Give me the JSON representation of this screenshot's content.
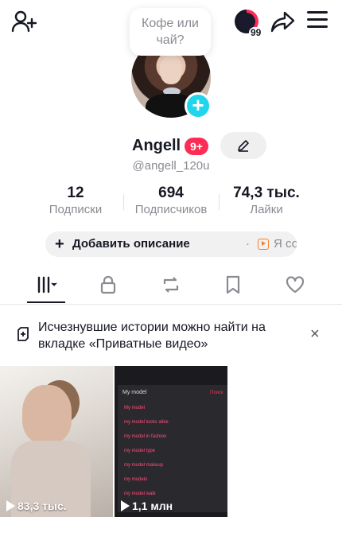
{
  "header": {
    "add_friend_icon": "add-friend-icon",
    "status_bubble": [
      "Кофе или",
      "чай?"
    ],
    "notification_count": "99",
    "share_icon": "share-icon",
    "menu_icon": "hamburger-menu-icon"
  },
  "profile": {
    "name": "Angell",
    "badge": "9+",
    "handle": "@angell_120u",
    "stats": [
      {
        "value": "12",
        "label": "Подписки"
      },
      {
        "value": "694",
        "label": "Подписчиков"
      },
      {
        "value": "74,3 тыс.",
        "label": "Лайки"
      }
    ],
    "description_button": "Добавить описание",
    "description_separator": "·",
    "create_label": "Я созда..."
  },
  "tabs": [
    {
      "name": "videos-grid",
      "icon": "grid-icon",
      "active": true
    },
    {
      "name": "private",
      "icon": "lock-icon"
    },
    {
      "name": "reposts",
      "icon": "repost-icon"
    },
    {
      "name": "saved",
      "icon": "bookmark-icon"
    },
    {
      "name": "liked",
      "icon": "heart-icon"
    }
  ],
  "notice": {
    "text": "Исчезнувшие истории можно найти на вкладке «Приватные видео»",
    "close": "×"
  },
  "videos": [
    {
      "views": "83,3 тыс."
    },
    {
      "views": "1,1 млн",
      "search_query": "My model",
      "cancel": "Поиск",
      "suggestions": [
        "My model",
        "my model looks alike",
        "my model in fashion",
        "my model type",
        "my model makeup",
        "my modelo",
        "my model walk"
      ]
    }
  ],
  "colors": {
    "accent": "#fe2c55",
    "cyan": "#20d5ec",
    "muted": "#8a8b91"
  }
}
